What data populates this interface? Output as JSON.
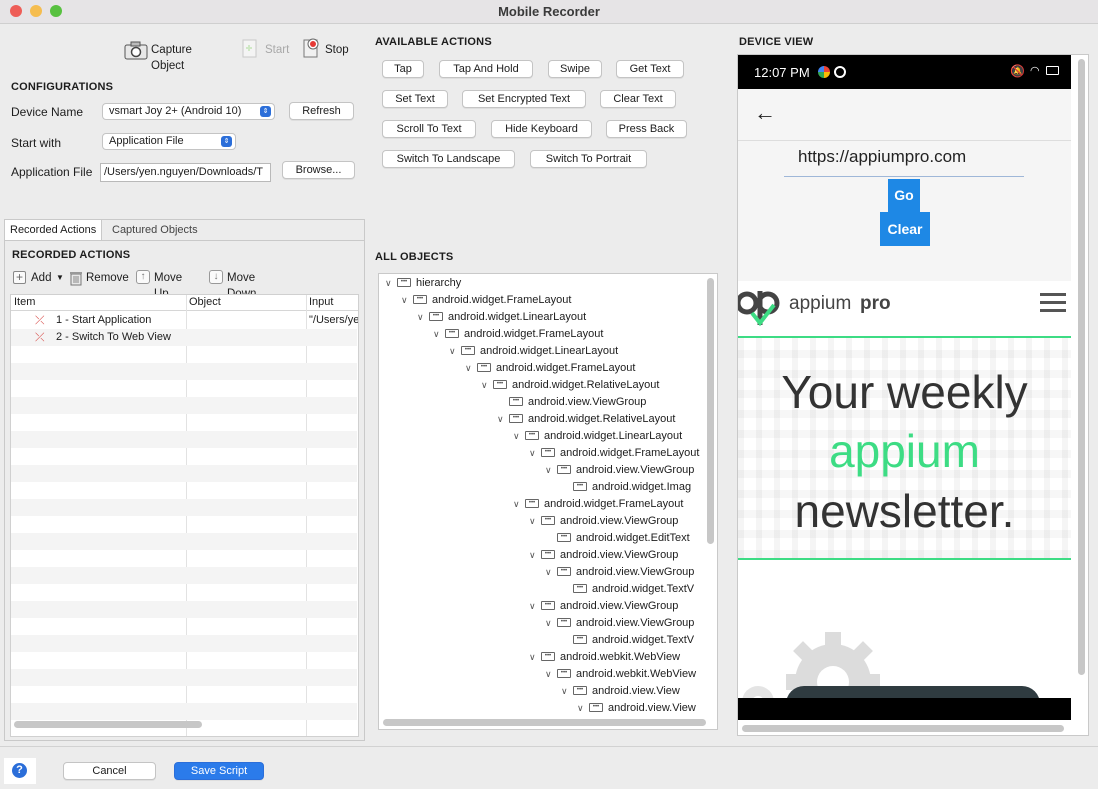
{
  "window": {
    "title": "Mobile Recorder"
  },
  "toolbar": {
    "capture_label": "Capture Object",
    "start_label": "Start",
    "stop_label": "Stop"
  },
  "configurations": {
    "header": "CONFIGURATIONS",
    "device_name_label": "Device Name",
    "device_name_value": "vsmart Joy 2+ (Android 10)",
    "refresh_label": "Refresh",
    "start_with_label": "Start with",
    "start_with_value": "Application File",
    "app_file_label": "Application File",
    "app_file_value": "/Users/yen.nguyen/Downloads/T",
    "browse_label": "Browse..."
  },
  "tabs": {
    "recorded": "Recorded Actions",
    "captured": "Captured Objects"
  },
  "recorded_actions": {
    "header": "RECORDED ACTIONS",
    "add": "Add",
    "remove": "Remove",
    "move_up": "Move Up",
    "move_down": "Move Down",
    "columns": [
      "Item",
      "Object",
      "Input"
    ],
    "rows": [
      {
        "item": "1 - Start Application",
        "object": "",
        "input": "\"/Users/ye"
      },
      {
        "item": "2 - Switch To Web View",
        "object": "",
        "input": ""
      }
    ]
  },
  "available_actions": {
    "header": "AVAILABLE ACTIONS",
    "buttons": [
      "Tap",
      "Tap And Hold",
      "Swipe",
      "Get Text",
      "Set Text",
      "Set Encrypted Text",
      "Clear Text",
      "Scroll To Text",
      "Hide Keyboard",
      "Press Back",
      "Switch To Landscape",
      "Switch To Portrait"
    ]
  },
  "all_objects": {
    "header": "ALL OBJECTS",
    "nodes": [
      {
        "label": "hierarchy",
        "depth": 0
      },
      {
        "label": "android.widget.FrameLayout",
        "depth": 1
      },
      {
        "label": "android.widget.LinearLayout",
        "depth": 2
      },
      {
        "label": "android.widget.FrameLayout",
        "depth": 3
      },
      {
        "label": "android.widget.LinearLayout",
        "depth": 4
      },
      {
        "label": "android.widget.FrameLayout",
        "depth": 5
      },
      {
        "label": "android.widget.RelativeLayout",
        "depth": 6
      },
      {
        "label": "android.view.ViewGroup",
        "depth": 7,
        "leaf": true
      },
      {
        "label": "android.widget.RelativeLayout",
        "depth": 7
      },
      {
        "label": "android.widget.LinearLayout",
        "depth": 8
      },
      {
        "label": "android.widget.FrameLayout",
        "depth": 9
      },
      {
        "label": "android.view.ViewGroup",
        "depth": 10
      },
      {
        "label": "android.widget.Imag",
        "depth": 11,
        "leaf": true
      },
      {
        "label": "android.widget.FrameLayout",
        "depth": 8
      },
      {
        "label": "android.view.ViewGroup",
        "depth": 9
      },
      {
        "label": "android.widget.EditText",
        "depth": 10,
        "leaf": true
      },
      {
        "label": "android.view.ViewGroup",
        "depth": 9
      },
      {
        "label": "android.view.ViewGroup",
        "depth": 10
      },
      {
        "label": "android.widget.TextV",
        "depth": 11,
        "leaf": true
      },
      {
        "label": "android.view.ViewGroup",
        "depth": 9
      },
      {
        "label": "android.view.ViewGroup",
        "depth": 10
      },
      {
        "label": "android.widget.TextV",
        "depth": 11,
        "leaf": true
      },
      {
        "label": "android.webkit.WebView",
        "depth": 9
      },
      {
        "label": "android.webkit.WebView",
        "depth": 10
      },
      {
        "label": "android.view.View",
        "depth": 11
      },
      {
        "label": "android.view.View",
        "depth": 12
      }
    ]
  },
  "device_view": {
    "header": "DEVICE VIEW",
    "time": "12:07 PM",
    "url": "https://appiumpro.com",
    "go": "Go",
    "clear": "Clear",
    "brand_a": "appium",
    "brand_b": "pro",
    "headline_1": "Your weekly",
    "headline_2": "appium",
    "headline_3": "newsletter."
  },
  "footer": {
    "help": "?",
    "cancel": "Cancel",
    "save": "Save Script"
  },
  "colors": {
    "accent": "#2b6ed9",
    "green": "#3ddc84",
    "mobile_blue": "#1e88e5"
  }
}
